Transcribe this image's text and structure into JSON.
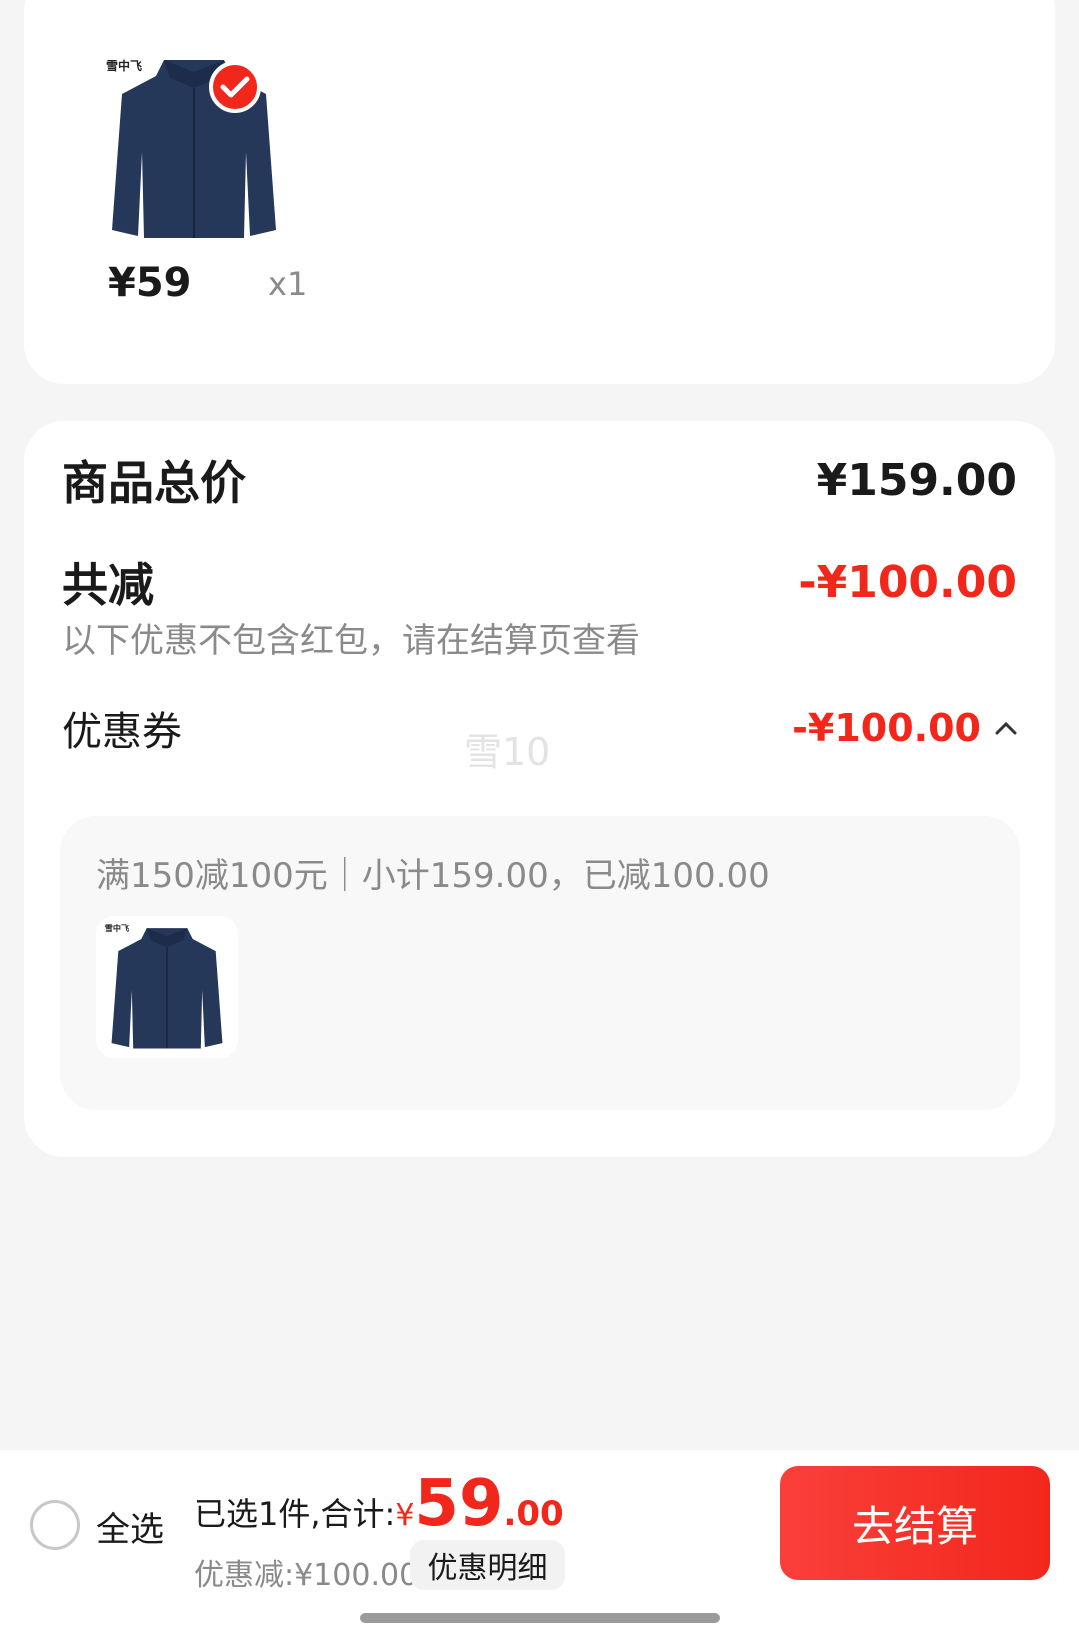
{
  "product": {
    "brand_logo": "雪中飞",
    "price": "¥59",
    "qty": "x1",
    "check_icon": "check-icon"
  },
  "summary": {
    "total_label": "商品总价",
    "total_amount": "¥159.00",
    "discount_label": "共减",
    "discount_amount": "-¥100.00",
    "hint": "以下优惠不包含红包，请在结算页查看",
    "coupon_label": "优惠券",
    "coupon_amount": "-¥100.00",
    "watermark": "雪10",
    "coupon_rule": "满150减100元｜小计159.00，已减100.00"
  },
  "bottom": {
    "select_all": "全选",
    "selected_text": "已选1件,合计:",
    "yen": "¥",
    "total_int": "59",
    "total_dec": ".00",
    "saved": "优惠减:¥100.00",
    "detail_button": "优惠明细",
    "checkout_button": "去结算"
  },
  "colors": {
    "accent": "#f2271c",
    "bg": "#f5f5f5"
  }
}
